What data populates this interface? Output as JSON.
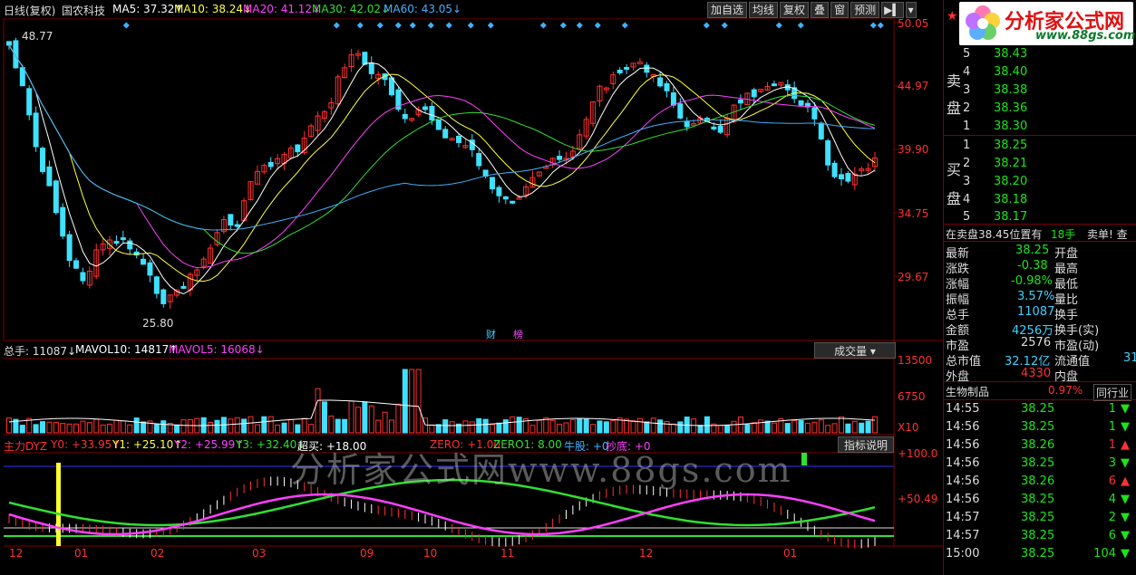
{
  "header": {
    "period": "日线(复权)",
    "stock_name": "国农科技",
    "ma5": "MA5: 37.32↑",
    "ma10": "MA10: 38.24↓",
    "ma20": "MA20: 41.12↓",
    "ma30": "MA30: 42.02↓",
    "ma60": "MA60: 43.05↓",
    "toolbar": [
      "加自选",
      "均线",
      "复权",
      "叠",
      "窗",
      "预测"
    ]
  },
  "price_axis": [
    "50.05",
    "44.97",
    "39.90",
    "34.75",
    "29.67"
  ],
  "price_marks": {
    "high": "48.77",
    "low": "25.80"
  },
  "event_labels": [
    "财",
    "榜"
  ],
  "volume_panel": {
    "total": "总手: 11087↓",
    "mavol10": "MAVOL10: 14817↑",
    "mavol5": "MAVOL5: 16068↓",
    "selector": "成交量",
    "axis": [
      "13500",
      "6750",
      "X10"
    ]
  },
  "indicator_panel": {
    "label": "主力DYZ",
    "y0": "Y0: +33.95↑",
    "y1": "Y1: +25.10↑",
    "y2": "Y2: +25.99↑",
    "y3": "Y3: +32.40↓",
    "chaomai": "超买: +18.00",
    "zero": "ZERO: +1.00",
    "zero1": "ZERO1: 8.00",
    "niugu": "牛股: +0",
    "chaodi": "抄底: +0",
    "button": "指标说明",
    "axis": [
      "+100.0",
      "+50.49"
    ]
  },
  "x_axis": [
    "12",
    "01",
    "02",
    "03",
    "09",
    "10",
    "11",
    "12",
    "01"
  ],
  "watermark": "分析家公式网www.88gs.com",
  "logo": {
    "title": "分析家公式网",
    "url": "www.88gs.com"
  },
  "orderbook": {
    "sell_label": [
      "卖",
      "盘"
    ],
    "buy_label": [
      "买",
      "盘"
    ],
    "sell": [
      {
        "n": "5",
        "price": "38.43"
      },
      {
        "n": "4",
        "price": "38.40"
      },
      {
        "n": "3",
        "price": "38.38"
      },
      {
        "n": "2",
        "price": "38.36"
      },
      {
        "n": "1",
        "price": "38.30"
      }
    ],
    "buy": [
      {
        "n": "1",
        "price": "38.25"
      },
      {
        "n": "2",
        "price": "38.21"
      },
      {
        "n": "3",
        "price": "38.20"
      },
      {
        "n": "4",
        "price": "38.18"
      },
      {
        "n": "5",
        "price": "38.17"
      }
    ]
  },
  "notice": {
    "text": "在卖盘38.45位置有",
    "qty": "18手",
    "action": "卖单! 查"
  },
  "quote": [
    {
      "k": "最新",
      "v": "38.25",
      "k2": "开盘",
      "c": "green"
    },
    {
      "k": "涨跌",
      "v": "-0.38",
      "k2": "最高",
      "c": "green"
    },
    {
      "k": "涨幅",
      "v": "-0.98%",
      "k2": "最低",
      "c": "green"
    },
    {
      "k": "振幅",
      "v": "3.57%",
      "k2": "量比",
      "c": "cyan"
    },
    {
      "k": "总手",
      "v": "11087",
      "k2": "换手",
      "c": "cyan"
    },
    {
      "k": "金额",
      "v": "4256万",
      "k2": "换手(实)",
      "c": "cyan"
    },
    {
      "k": "市盈",
      "v": "2576",
      "k2": "市盈(动)",
      "c": "white"
    },
    {
      "k": "总市值",
      "v": "32.12亿",
      "k2": "流通值",
      "c": "cyan",
      "v2": "31"
    },
    {
      "k": "外盘",
      "v": "4330",
      "k2": "内盘",
      "c": "red"
    }
  ],
  "sector": {
    "name": "生物制品",
    "pct": "0.97%",
    "tab": "同行业"
  },
  "ticks": [
    {
      "t": "14:55",
      "p": "38.25",
      "q": "1",
      "dir": "down"
    },
    {
      "t": "14:56",
      "p": "38.25",
      "q": "1",
      "dir": "down"
    },
    {
      "t": "14:56",
      "p": "38.26",
      "q": "1",
      "dir": "up"
    },
    {
      "t": "14:56",
      "p": "38.25",
      "q": "3",
      "dir": "down"
    },
    {
      "t": "14:56",
      "p": "38.26",
      "q": "6",
      "dir": "up"
    },
    {
      "t": "14:56",
      "p": "38.25",
      "q": "4",
      "dir": "down"
    },
    {
      "t": "14:57",
      "p": "38.25",
      "q": "2",
      "dir": "down"
    },
    {
      "t": "14:57",
      "p": "38.25",
      "q": "6",
      "dir": "down"
    },
    {
      "t": "15:00",
      "p": "38.25",
      "q": "104",
      "dir": "down"
    }
  ],
  "colors": {
    "up": "#ff3030",
    "down": "#40e0ff",
    "ma5": "#ffffff",
    "ma10": "#ffff40",
    "ma20": "#ff40ff",
    "ma30": "#30e030",
    "ma60": "#40b0ff",
    "grid": "#800000"
  }
}
